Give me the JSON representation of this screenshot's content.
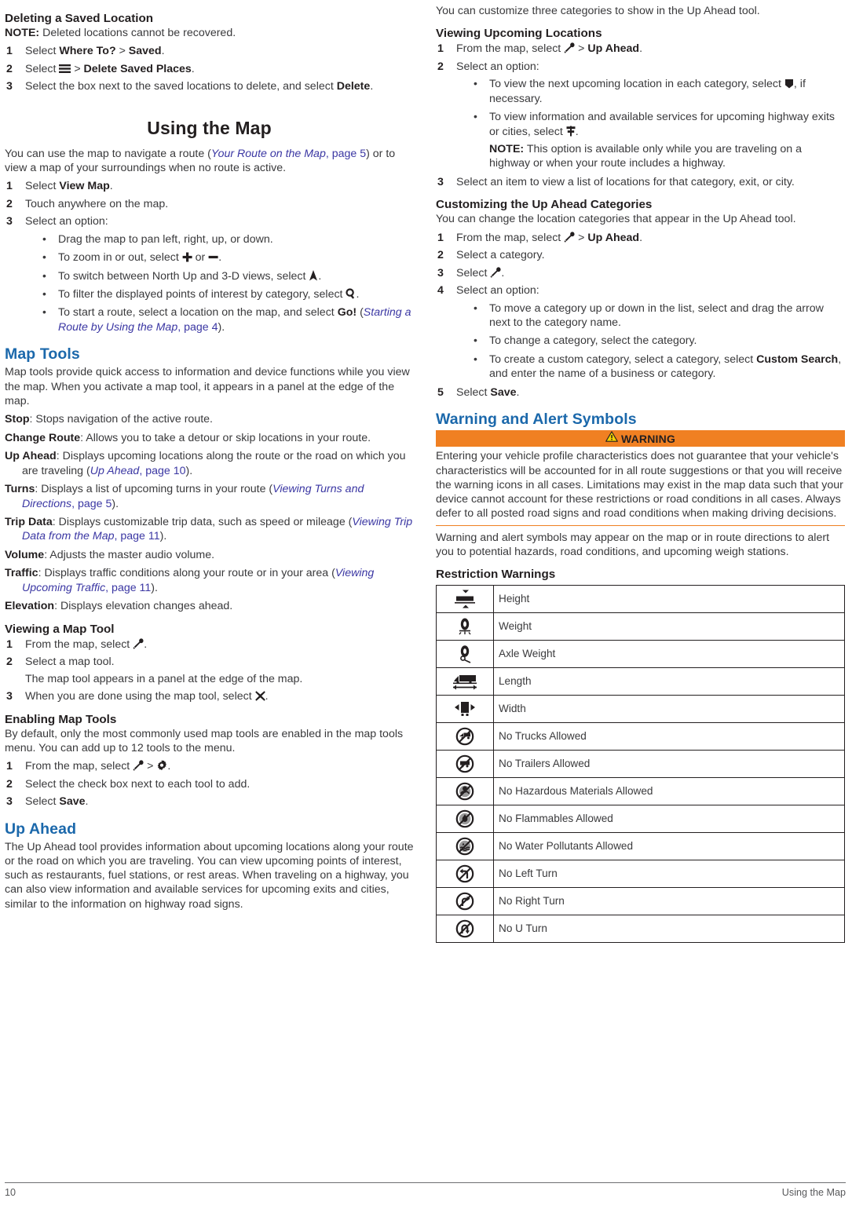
{
  "document": {
    "footer": {
      "page_number": "10",
      "section": "Using the Map"
    }
  },
  "left_column": {
    "s_deleting": {
      "heading": "Deleting a Saved Location",
      "note_label": "NOTE:",
      "note_text": " Deleted locations cannot be recovered.",
      "steps": [
        {
          "pre": "Select ",
          "b1": "Where To?",
          "mid": " > ",
          "b2": "Saved",
          "post": "."
        },
        {
          "pre": "Select ",
          "icon": "menu-icon",
          "mid": " > ",
          "b2": "Delete Saved Places",
          "post": "."
        },
        {
          "pre": "Select the box next to the saved locations to delete, and select ",
          "b2": "Delete",
          "post": "."
        }
      ]
    },
    "chapter_title": "Using the Map",
    "s_usingmap": {
      "intro_a": "You can use the map to navigate a route (",
      "intro_link": "Your Route on the Map",
      "intro_link_page": ", page 5",
      "intro_b": ") or to view a map of your surroundings when no route is active.",
      "steps": [
        {
          "pre": "Select ",
          "b": "View Map",
          "post": "."
        },
        {
          "pre": "Touch anywhere on the map.",
          "b": "",
          "post": ""
        },
        {
          "pre": "Select an option:",
          "b": "",
          "post": ""
        }
      ],
      "bullets": [
        {
          "text": "Drag the map to pan left, right, up, or down."
        },
        {
          "pre": "To zoom in or out, select ",
          "icon1": "plus-icon",
          "mid": " or ",
          "icon2": "minus-icon",
          "post": "."
        },
        {
          "pre": "To switch between North Up and 3-D views, select ",
          "icon1": "north-up-arrow-icon",
          "post": "."
        },
        {
          "pre": "To filter the displayed points of interest by category, select ",
          "icon1": "search-icon",
          "post": "."
        },
        {
          "pre": "To start a route, select a location on the map, and select ",
          "b": "Go!",
          "mid2": " (",
          "link": "Starting a Route by Using the Map",
          "linkpage": ", page 4",
          "post": ")."
        }
      ]
    },
    "s_maptools": {
      "heading": "Map Tools",
      "intro": "Map tools provide quick access to information and device functions while you view the map. When you activate a map tool, it appears in a panel at the edge of the map.",
      "definitions": [
        {
          "term": "Stop",
          "text": ": Stops navigation of the active route."
        },
        {
          "term": "Change Route",
          "text": ": Allows you to take a detour or skip locations in your route."
        },
        {
          "term": "Up Ahead",
          "text": ": Displays upcoming locations along the route or the road on which you are traveling (",
          "link": "Up Ahead",
          "linkpage": ", page 10",
          "tail": ")."
        },
        {
          "term": "Turns",
          "text": ": Displays a list of upcoming turns in your route (",
          "link": "Viewing Turns and Directions",
          "linkpage": ", page 5",
          "tail": ")."
        },
        {
          "term": "Trip Data",
          "text": ": Displays customizable trip data, such as speed or mileage (",
          "link": "Viewing Trip Data from the Map",
          "linkpage": ", page 11",
          "tail": ")."
        },
        {
          "term": "Volume",
          "text": ": Adjusts the master audio volume."
        },
        {
          "term": "Traffic",
          "text": ": Displays traffic conditions along your route or in your area (",
          "link": "Viewing Upcoming Traffic",
          "linkpage": ", page 11",
          "tail": ")."
        },
        {
          "term": "Elevation",
          "text": ": Displays elevation changes ahead."
        }
      ]
    },
    "s_viewtool": {
      "heading": "Viewing a Map Tool",
      "steps": [
        {
          "pre": "From the map, select ",
          "icon": "wrench-icon",
          "post": "."
        },
        {
          "pre": "Select a map tool.",
          "cont": "The map tool appears in a panel at the edge of the map."
        },
        {
          "pre": "When you are done using the map tool, select ",
          "icon": "close-x-icon",
          "post": "."
        }
      ]
    },
    "s_enabletools": {
      "heading": "Enabling Map Tools",
      "intro": "By default, only the most commonly used map tools are enabled in the map tools menu. You can add up to 12 tools to the menu.",
      "steps": [
        {
          "pre": "From the map, select ",
          "icon": "wrench-icon",
          "mid": " > ",
          "icon2": "gear-icon",
          "post": "."
        },
        {
          "pre": "Select the check box next to each tool to add.",
          "post": ""
        },
        {
          "pre": "Select ",
          "b": "Save",
          "post": "."
        }
      ]
    },
    "s_upahead": {
      "heading": "Up Ahead",
      "intro": "The Up Ahead tool provides information about upcoming locations along your route or the road on which you are traveling. You can view upcoming points of interest, such as restaurants, fuel stations, or rest areas. When traveling on a highway, you can also view information and available services for upcoming exits and cities, similar to the information on highway road signs."
    }
  },
  "right_column": {
    "upahead_cont": "You can customize three categories to show in the Up Ahead tool.",
    "s_viewing_upcoming": {
      "heading": "Viewing Upcoming Locations",
      "steps": [
        {
          "pre": "From the map, select ",
          "icon": "wrench-icon",
          "mid": " > ",
          "b": "Up Ahead",
          "post": "."
        },
        {
          "pre": "Select an option:",
          "post": ""
        },
        {
          "pre": "Select an item to view a list of locations for that category, exit, or city.",
          "post": ""
        }
      ],
      "bullets": [
        {
          "pre": "To view the next upcoming location in each category, select ",
          "icon": "down-marker-icon",
          "post": ", if necessary."
        },
        {
          "pre": "To view information and available services for upcoming highway exits or cities, select ",
          "icon": "signpost-icon",
          "post": ".",
          "note_label": "NOTE:",
          "note_text": " This option is available only while you are traveling on a highway or when your route includes a highway."
        }
      ]
    },
    "s_customizing": {
      "heading": "Customizing the Up Ahead Categories",
      "intro": "You can change the location categories that appear in the Up Ahead tool.",
      "steps": [
        {
          "pre": "From the map, select ",
          "icon": "wrench-icon",
          "mid": " > ",
          "b": "Up Ahead",
          "post": "."
        },
        {
          "pre": "Select a category.",
          "post": ""
        },
        {
          "pre": "Select ",
          "icon": "wrench-icon",
          "post": "."
        },
        {
          "pre": "Select an option:",
          "post": ""
        },
        {
          "pre": "Select ",
          "b": "Save",
          "post": "."
        }
      ],
      "bullets": [
        {
          "text": "To move a category up or down in the list, select and drag the arrow next to the category name."
        },
        {
          "text": "To change a category, select the category."
        },
        {
          "pre": "To create a custom category, select a category, select ",
          "b": "Custom Search",
          "post": ", and enter the name of a business or category."
        }
      ]
    },
    "s_warning": {
      "heading": "Warning and Alert Symbols",
      "banner_label": "WARNING",
      "banner_color": "#f08022",
      "warning_text": "Entering your vehicle profile characteristics does not guarantee that your vehicle's characteristics will be accounted for in all route suggestions or that you will receive the warning icons in all cases. Limitations may exist in the map data such that your device cannot account for these restrictions or road conditions in all cases. Always defer to all posted road signs and road conditions when making driving decisions.",
      "after_text": "Warning and alert symbols may appear on the map or in route directions to alert you to potential hazards, road conditions, and upcoming weigh stations."
    },
    "s_restrictions": {
      "heading": "Restriction Warnings",
      "rows": [
        {
          "icon": "truck-height-icon",
          "label": "Height"
        },
        {
          "icon": "tire-weight-icon",
          "label": "Weight"
        },
        {
          "icon": "tire-axle-weight-icon",
          "label": "Axle Weight"
        },
        {
          "icon": "truck-length-icon",
          "label": "Length"
        },
        {
          "icon": "truck-width-icon",
          "label": "Width"
        },
        {
          "icon": "no-trucks-icon",
          "label": "No Trucks Allowed"
        },
        {
          "icon": "no-trailers-icon",
          "label": "No Trailers Allowed"
        },
        {
          "icon": "no-hazmat-icon",
          "label": "No Hazardous Materials Allowed"
        },
        {
          "icon": "no-flammables-icon",
          "label": "No Flammables Allowed"
        },
        {
          "icon": "no-water-pollutants-icon",
          "label": "No Water Pollutants Allowed"
        },
        {
          "icon": "no-left-turn-icon",
          "label": "No Left Turn"
        },
        {
          "icon": "no-right-turn-icon",
          "label": "No Right Turn"
        },
        {
          "icon": "no-u-turn-icon",
          "label": "No U Turn"
        }
      ]
    }
  }
}
